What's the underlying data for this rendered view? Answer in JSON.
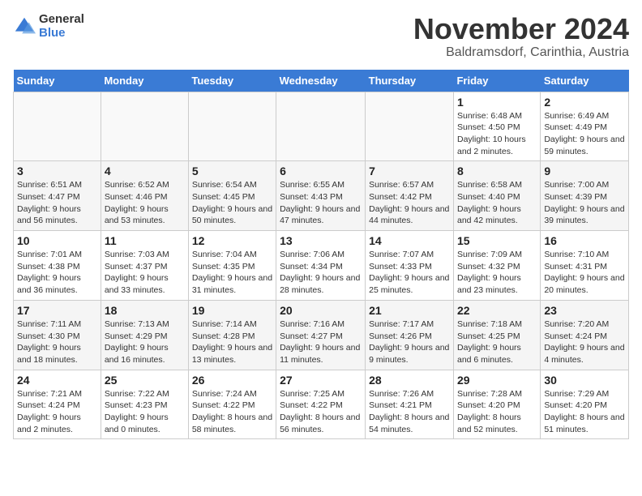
{
  "logo": {
    "general": "General",
    "blue": "Blue"
  },
  "title": {
    "month_year": "November 2024",
    "location": "Baldramsdorf, Carinthia, Austria"
  },
  "days_of_week": [
    "Sunday",
    "Monday",
    "Tuesday",
    "Wednesday",
    "Thursday",
    "Friday",
    "Saturday"
  ],
  "weeks": [
    {
      "cells": [
        {
          "empty": true
        },
        {
          "empty": true
        },
        {
          "empty": true
        },
        {
          "empty": true
        },
        {
          "empty": true
        },
        {
          "day": 1,
          "sunrise": "6:48 AM",
          "sunset": "4:50 PM",
          "daylight": "10 hours and 2 minutes."
        },
        {
          "day": 2,
          "sunrise": "6:49 AM",
          "sunset": "4:49 PM",
          "daylight": "9 hours and 59 minutes."
        }
      ]
    },
    {
      "cells": [
        {
          "day": 3,
          "sunrise": "6:51 AM",
          "sunset": "4:47 PM",
          "daylight": "9 hours and 56 minutes."
        },
        {
          "day": 4,
          "sunrise": "6:52 AM",
          "sunset": "4:46 PM",
          "daylight": "9 hours and 53 minutes."
        },
        {
          "day": 5,
          "sunrise": "6:54 AM",
          "sunset": "4:45 PM",
          "daylight": "9 hours and 50 minutes."
        },
        {
          "day": 6,
          "sunrise": "6:55 AM",
          "sunset": "4:43 PM",
          "daylight": "9 hours and 47 minutes."
        },
        {
          "day": 7,
          "sunrise": "6:57 AM",
          "sunset": "4:42 PM",
          "daylight": "9 hours and 44 minutes."
        },
        {
          "day": 8,
          "sunrise": "6:58 AM",
          "sunset": "4:40 PM",
          "daylight": "9 hours and 42 minutes."
        },
        {
          "day": 9,
          "sunrise": "7:00 AM",
          "sunset": "4:39 PM",
          "daylight": "9 hours and 39 minutes."
        }
      ]
    },
    {
      "cells": [
        {
          "day": 10,
          "sunrise": "7:01 AM",
          "sunset": "4:38 PM",
          "daylight": "9 hours and 36 minutes."
        },
        {
          "day": 11,
          "sunrise": "7:03 AM",
          "sunset": "4:37 PM",
          "daylight": "9 hours and 33 minutes."
        },
        {
          "day": 12,
          "sunrise": "7:04 AM",
          "sunset": "4:35 PM",
          "daylight": "9 hours and 31 minutes."
        },
        {
          "day": 13,
          "sunrise": "7:06 AM",
          "sunset": "4:34 PM",
          "daylight": "9 hours and 28 minutes."
        },
        {
          "day": 14,
          "sunrise": "7:07 AM",
          "sunset": "4:33 PM",
          "daylight": "9 hours and 25 minutes."
        },
        {
          "day": 15,
          "sunrise": "7:09 AM",
          "sunset": "4:32 PM",
          "daylight": "9 hours and 23 minutes."
        },
        {
          "day": 16,
          "sunrise": "7:10 AM",
          "sunset": "4:31 PM",
          "daylight": "9 hours and 20 minutes."
        }
      ]
    },
    {
      "cells": [
        {
          "day": 17,
          "sunrise": "7:11 AM",
          "sunset": "4:30 PM",
          "daylight": "9 hours and 18 minutes."
        },
        {
          "day": 18,
          "sunrise": "7:13 AM",
          "sunset": "4:29 PM",
          "daylight": "9 hours and 16 minutes."
        },
        {
          "day": 19,
          "sunrise": "7:14 AM",
          "sunset": "4:28 PM",
          "daylight": "9 hours and 13 minutes."
        },
        {
          "day": 20,
          "sunrise": "7:16 AM",
          "sunset": "4:27 PM",
          "daylight": "9 hours and 11 minutes."
        },
        {
          "day": 21,
          "sunrise": "7:17 AM",
          "sunset": "4:26 PM",
          "daylight": "9 hours and 9 minutes."
        },
        {
          "day": 22,
          "sunrise": "7:18 AM",
          "sunset": "4:25 PM",
          "daylight": "9 hours and 6 minutes."
        },
        {
          "day": 23,
          "sunrise": "7:20 AM",
          "sunset": "4:24 PM",
          "daylight": "9 hours and 4 minutes."
        }
      ]
    },
    {
      "cells": [
        {
          "day": 24,
          "sunrise": "7:21 AM",
          "sunset": "4:24 PM",
          "daylight": "9 hours and 2 minutes."
        },
        {
          "day": 25,
          "sunrise": "7:22 AM",
          "sunset": "4:23 PM",
          "daylight": "9 hours and 0 minutes."
        },
        {
          "day": 26,
          "sunrise": "7:24 AM",
          "sunset": "4:22 PM",
          "daylight": "8 hours and 58 minutes."
        },
        {
          "day": 27,
          "sunrise": "7:25 AM",
          "sunset": "4:22 PM",
          "daylight": "8 hours and 56 minutes."
        },
        {
          "day": 28,
          "sunrise": "7:26 AM",
          "sunset": "4:21 PM",
          "daylight": "8 hours and 54 minutes."
        },
        {
          "day": 29,
          "sunrise": "7:28 AM",
          "sunset": "4:20 PM",
          "daylight": "8 hours and 52 minutes."
        },
        {
          "day": 30,
          "sunrise": "7:29 AM",
          "sunset": "4:20 PM",
          "daylight": "8 hours and 51 minutes."
        }
      ]
    }
  ]
}
